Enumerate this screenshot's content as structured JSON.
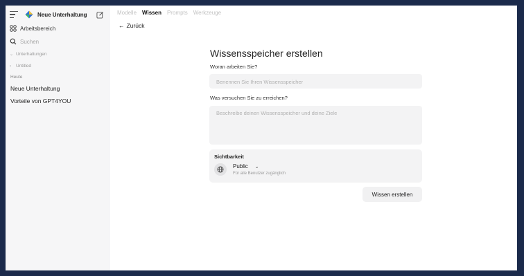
{
  "sidebar": {
    "new_chat_label": "Neue Unterhaltung",
    "workspace_label": "Arbeitsbereich",
    "search_placeholder": "Suchen",
    "groups": [
      {
        "label": "Unterhaltungen"
      },
      {
        "label": "Untitled"
      }
    ],
    "section_heading": "Heute",
    "chats": [
      {
        "label": "Neue Unterhaltung"
      },
      {
        "label": "Vorteile von GPT4YOU"
      }
    ]
  },
  "header": {
    "tabs": [
      {
        "label": "Modelle",
        "active": false
      },
      {
        "label": "Wissen",
        "active": true
      },
      {
        "label": "Prompts",
        "active": false
      },
      {
        "label": "Werkzeuge",
        "active": false
      }
    ],
    "back_label": "Zurück"
  },
  "form": {
    "title": "Wissensspeicher erstellen",
    "name_question": "Woran arbeiten Sie?",
    "name_placeholder": "Benennen Sie Ihren Wissensspeicher",
    "goal_question": "Was versuchen Sie zu erreichen?",
    "goal_placeholder": "Beschreibe deinen Wissensspeicher und deine Ziele",
    "visibility": {
      "title": "Sichtbarkeit",
      "selected": "Public",
      "description": "Für alle Benutzer zugänglich"
    },
    "submit_label": "Wissen erstellen"
  },
  "colors": {
    "frame": "#1b2a4b",
    "sidebar_bg": "#f6f6f7",
    "input_bg": "#f3f3f4"
  }
}
